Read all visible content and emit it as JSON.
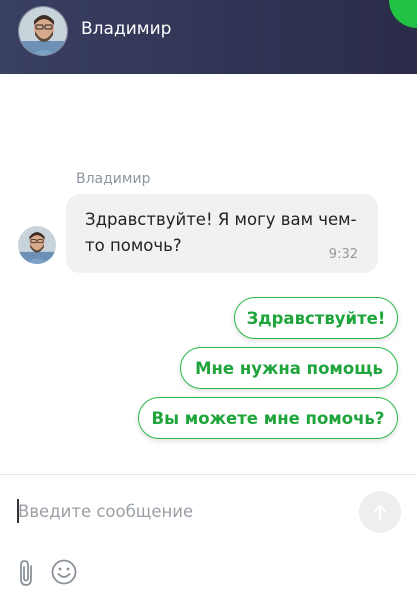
{
  "header": {
    "agent_name": "Владимир",
    "avatar_icon": "operator-avatar-photo",
    "accent_color": "#22c244",
    "background_color": "#323657"
  },
  "conversation": {
    "messages": [
      {
        "sender": "Владимир",
        "text": "Здравствуйте! Я могу вам чем-то помочь?",
        "time": "9:32"
      }
    ],
    "quick_replies": [
      "Здравствуйте!",
      "Мне нужна помощь",
      "Вы можете мне помочь?"
    ],
    "quick_reply_color": "#2bb84a"
  },
  "composer": {
    "placeholder": "Введите сообщение",
    "value": "",
    "send_icon": "arrow-up-icon",
    "attach_icon": "paperclip-icon",
    "emoji_icon": "smiley-icon"
  }
}
